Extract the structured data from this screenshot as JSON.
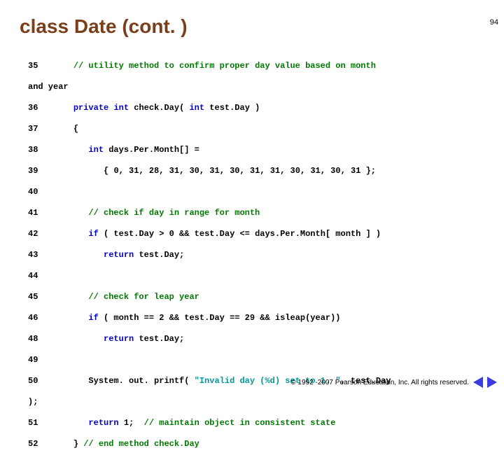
{
  "page_number": "94",
  "title": "class Date (cont. )",
  "code": {
    "r0_ln": "35",
    "r0_cm": "// utility method to confirm proper day value based on month",
    "r0b_noln": "and year",
    "r1_ln": "36",
    "r1_kw1": "private",
    "r1_kw2": "int",
    "r1_m": "check.Day( ",
    "r1_kw3": "int",
    "r1_m2": " test.Day )",
    "r2_ln": "37",
    "r2_s": "{",
    "r3_ln": "38",
    "r3_kw": "int",
    "r3_m": " days.Per.Month[] =",
    "r4_ln": "39",
    "r4_s1": "{ ",
    "r4_n1": "0",
    "r4_c": ", ",
    "r4_n2": "31",
    "r4_n3": "28",
    "r4_n4": "31",
    "r4_n5": "30",
    "r4_n6": "31",
    "r4_n7": "30",
    "r4_n8": "31",
    "r4_n9": "31",
    "r4_n10": "30",
    "r4_n11": "31",
    "r4_n12": "30",
    "r4_n13": "31",
    "r4_s2": " };",
    "r5_ln": "40",
    "r6_ln": "41",
    "r6_cm": "// check if day in range for month",
    "r7_ln": "42",
    "r7_kw": "if",
    "r7_m1": " ( test.Day > ",
    "r7_n1": "0",
    "r7_m2": " && test.Day <= days.Per.Month[ month ] )",
    "r8_ln": "43",
    "r8_kw": "return",
    "r8_m": " test.Day;",
    "r9_ln": "44",
    "r10_ln": "45",
    "r10_cm": "// check for leap year",
    "r11_ln": "46",
    "r11_kw": "if",
    "r11_m1": " ( month == ",
    "r11_n1": "2",
    "r11_m2": " && test.Day == ",
    "r11_n2": "29",
    "r11_m3": " && isleap(year))",
    "r12_ln": "48",
    "r12_kw": "return",
    "r12_m": " test.Day;",
    "r13_ln": "49",
    "r14_ln": "50",
    "r14_m1": "System. out. printf( ",
    "r14_str": "\"Invalid day (%d) set to 1. \"",
    "r14_m2": ", test.Day",
    "r14b_noln": ");",
    "r15_ln": "51",
    "r15_kw": "return",
    "r15_n": " 1",
    "r15_m": ";  ",
    "r15_cm": "// maintain object in consistent state",
    "r16_ln": "52",
    "r16_m": "} ",
    "r16_cm": "// end method check.Day"
  },
  "footer": {
    "copyright": "© 1992 -2007 Pearson Education, Inc. All rights reserved."
  }
}
